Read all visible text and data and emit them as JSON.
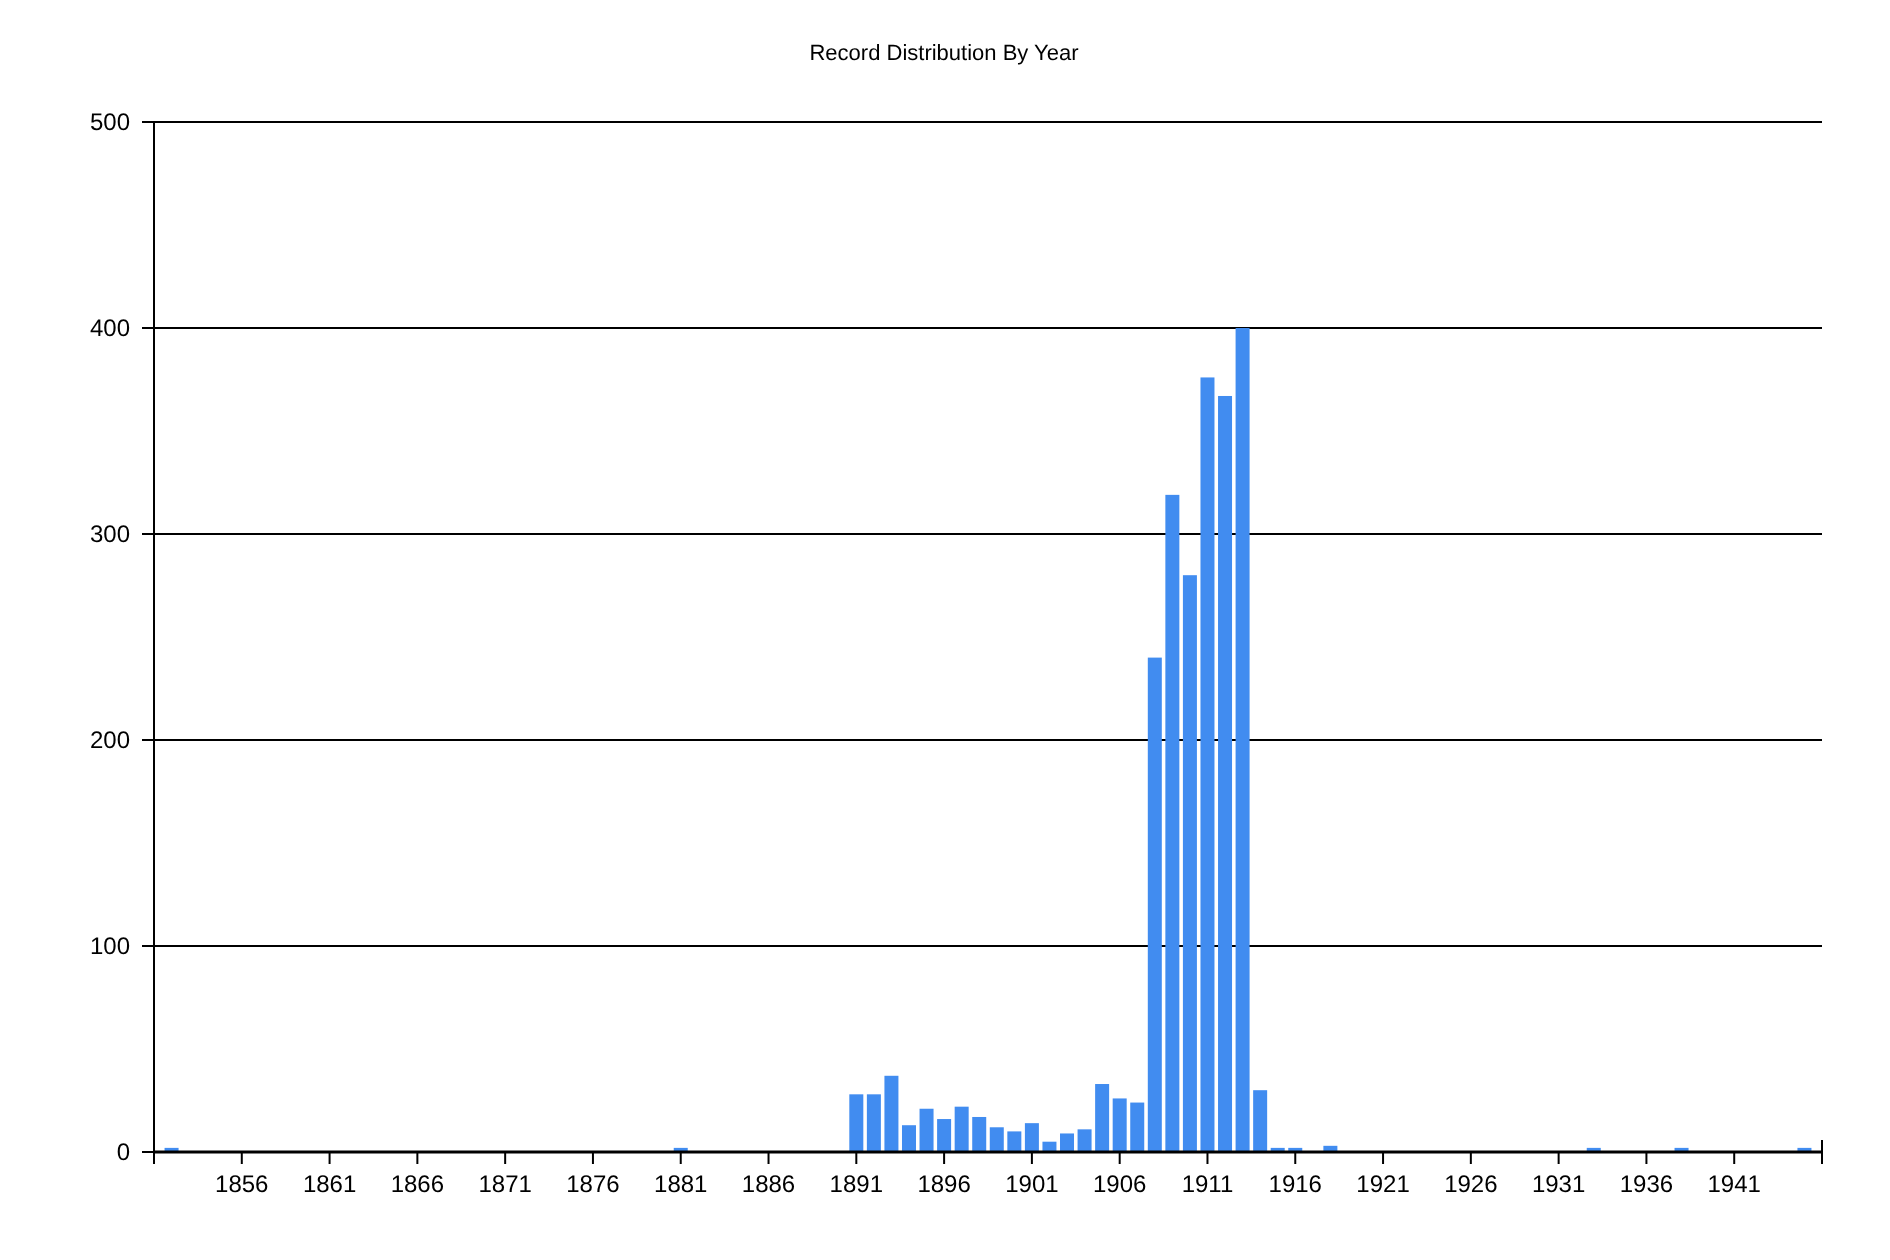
{
  "chart_data": {
    "type": "bar",
    "title": "Record Distribution By Year",
    "x": [
      1852,
      1881,
      1891,
      1892,
      1893,
      1894,
      1895,
      1896,
      1897,
      1898,
      1899,
      1900,
      1901,
      1902,
      1903,
      1904,
      1905,
      1906,
      1907,
      1908,
      1909,
      1910,
      1911,
      1912,
      1913,
      1914,
      1915,
      1916,
      1918,
      1933,
      1938,
      1945
    ],
    "values": [
      2,
      2,
      28,
      28,
      37,
      13,
      21,
      16,
      22,
      17,
      12,
      10,
      14,
      5,
      9,
      11,
      33,
      26,
      24,
      240,
      319,
      280,
      376,
      367,
      400,
      30,
      2,
      2,
      3,
      2,
      2,
      2
    ],
    "color": "#418cf0",
    "xlim": [
      1851,
      1946
    ],
    "ylim": [
      0,
      500
    ],
    "xticks": [
      1856,
      1861,
      1866,
      1871,
      1876,
      1881,
      1886,
      1891,
      1896,
      1901,
      1906,
      1911,
      1916,
      1921,
      1926,
      1931,
      1936,
      1941
    ],
    "yticks": [
      0,
      100,
      200,
      300,
      400,
      500
    ],
    "grid": true
  }
}
